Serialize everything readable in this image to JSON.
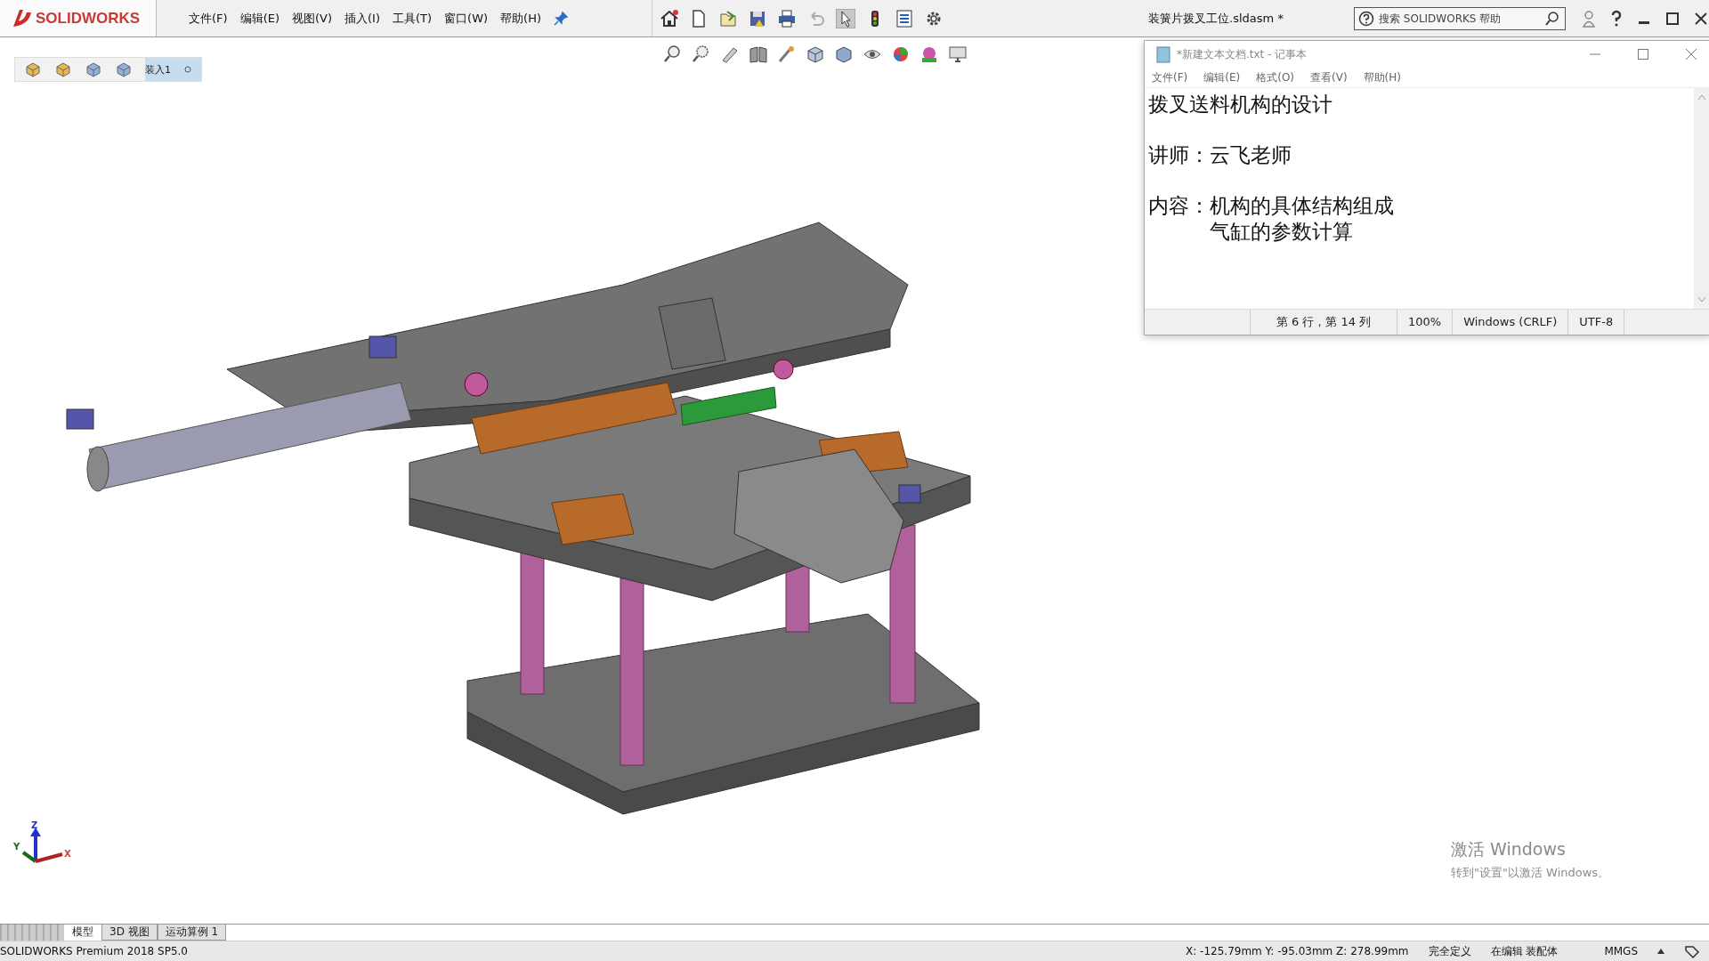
{
  "app": {
    "logo": "SOLIDWORKS",
    "menu": [
      "文件(F)",
      "编辑(E)",
      "视图(V)",
      "插入(I)",
      "工具(T)",
      "窗口(W)",
      "帮助(H)"
    ],
    "document_title": "装簧片拨叉工位.sldasm *",
    "search": {
      "placeholder": "搜索 SOLIDWORKS 帮助"
    }
  },
  "breadcrumb": {
    "label": "装入1"
  },
  "triad": {
    "z": "Z",
    "y": "Y",
    "x": "X"
  },
  "notepad": {
    "title": "*新建文本文档.txt - 记事本",
    "menu": [
      "文件(F)",
      "编辑(E)",
      "格式(O)",
      "查看(V)",
      "帮助(H)"
    ],
    "paragraphs": [
      {
        "lines": [
          "拨叉送料机构的设计"
        ]
      },
      {
        "label": "讲师：",
        "lines": [
          "云飞老师"
        ]
      },
      {
        "label": "内容：",
        "lines": [
          "机构的具体结构组成",
          "气缸的参数计算"
        ]
      }
    ],
    "status": [
      "第 6 行，第 14 列",
      "100%",
      "Windows (CRLF)",
      "UTF-8"
    ]
  },
  "activation": {
    "title": "激活 Windows",
    "hint": "转到\"设置\"以激活 Windows。"
  },
  "tabs": [
    {
      "label": "模型",
      "selected": true
    },
    {
      "label": "3D 视图",
      "selected": false
    },
    {
      "label": "运动算例 1",
      "selected": false
    }
  ],
  "status_bar": {
    "product": "SOLIDWORKS Premium 2018 SP5.0",
    "coordinates": "X: -125.79mm Y: -95.03mm Z: 278.99mm",
    "definition": "完全定义",
    "mode": "在编辑 装配体",
    "units": "MMGS"
  }
}
